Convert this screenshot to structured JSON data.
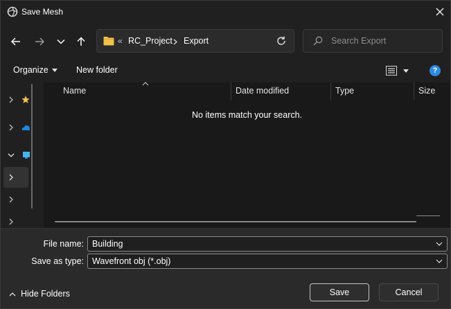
{
  "window": {
    "title": "Save Mesh"
  },
  "address": {
    "parent_overflow": "«",
    "crumbs": [
      "RC_Project",
      "Export"
    ]
  },
  "search": {
    "placeholder": "Search Export"
  },
  "commands": {
    "organize": "Organize",
    "new_folder": "New folder",
    "help": "?"
  },
  "columns": {
    "name": "Name",
    "date_modified": "Date modified",
    "type": "Type",
    "size": "Size"
  },
  "content": {
    "empty_message": "No items match your search."
  },
  "form": {
    "file_name_label": "File name:",
    "file_name_value": "Building",
    "save_type_label": "Save as type:",
    "save_type_value": "Wavefront obj (*.obj)"
  },
  "footer": {
    "hide_folders": "Hide Folders",
    "save": "Save",
    "cancel": "Cancel"
  },
  "colors": {
    "accent": "#2d8ae3",
    "folder": "#f3c24b",
    "background": "#202020",
    "content": "#191919"
  }
}
